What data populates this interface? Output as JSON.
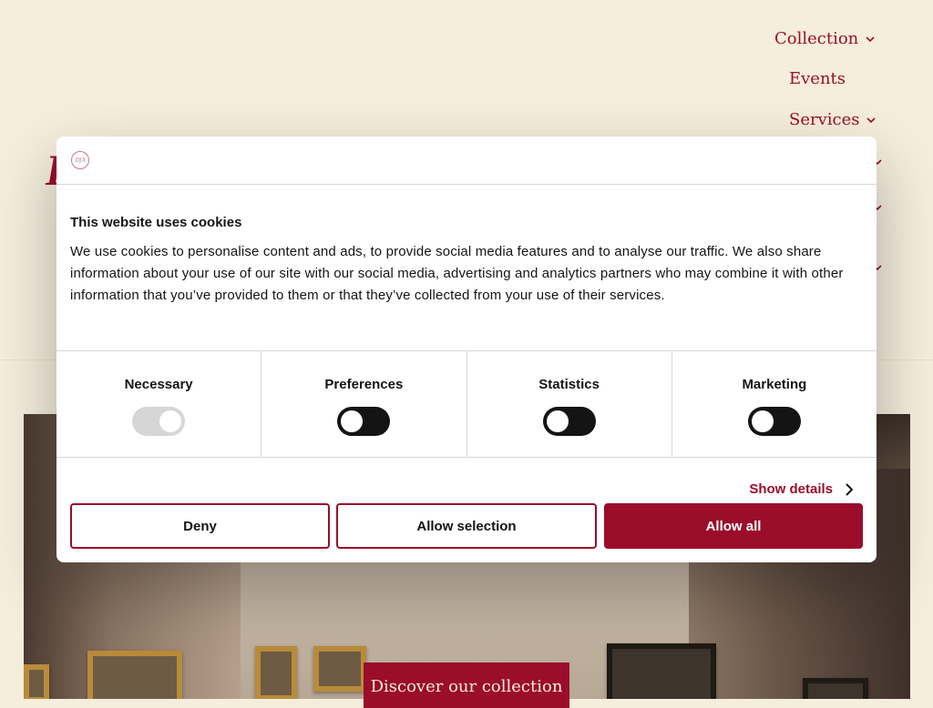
{
  "nav": {
    "items": [
      {
        "label": "Collection",
        "has_dropdown": true
      },
      {
        "label": "Events",
        "has_dropdown": false
      },
      {
        "label": "Services",
        "has_dropdown": true
      }
    ],
    "logo_fragment": "D"
  },
  "hero": {
    "cta_label": "Discover our collection"
  },
  "cookie_dialog": {
    "logo_text": "DfA",
    "title": "This website uses cookies",
    "description": "We use cookies to personalise content and ads, to provide social media features and to analyse our traffic. We also share information about your use of our site with our social media, advertising and analytics partners who may combine it with other information that you’ve provided to them or that they’ve collected from your use of their services.",
    "categories": [
      {
        "label": "Necessary",
        "enabled": true,
        "locked": true
      },
      {
        "label": "Preferences",
        "enabled": false,
        "locked": false
      },
      {
        "label": "Statistics",
        "enabled": false,
        "locked": false
      },
      {
        "label": "Marketing",
        "enabled": false,
        "locked": false
      }
    ],
    "show_details_label": "Show details",
    "buttons": {
      "deny": "Deny",
      "allow_selection": "Allow selection",
      "allow_all": "Allow all"
    }
  },
  "colors": {
    "brand": "#9b0d2a",
    "page_background": "#f5eedd",
    "toggle_off": "#141414",
    "toggle_disabled": "#d6d6d6"
  }
}
